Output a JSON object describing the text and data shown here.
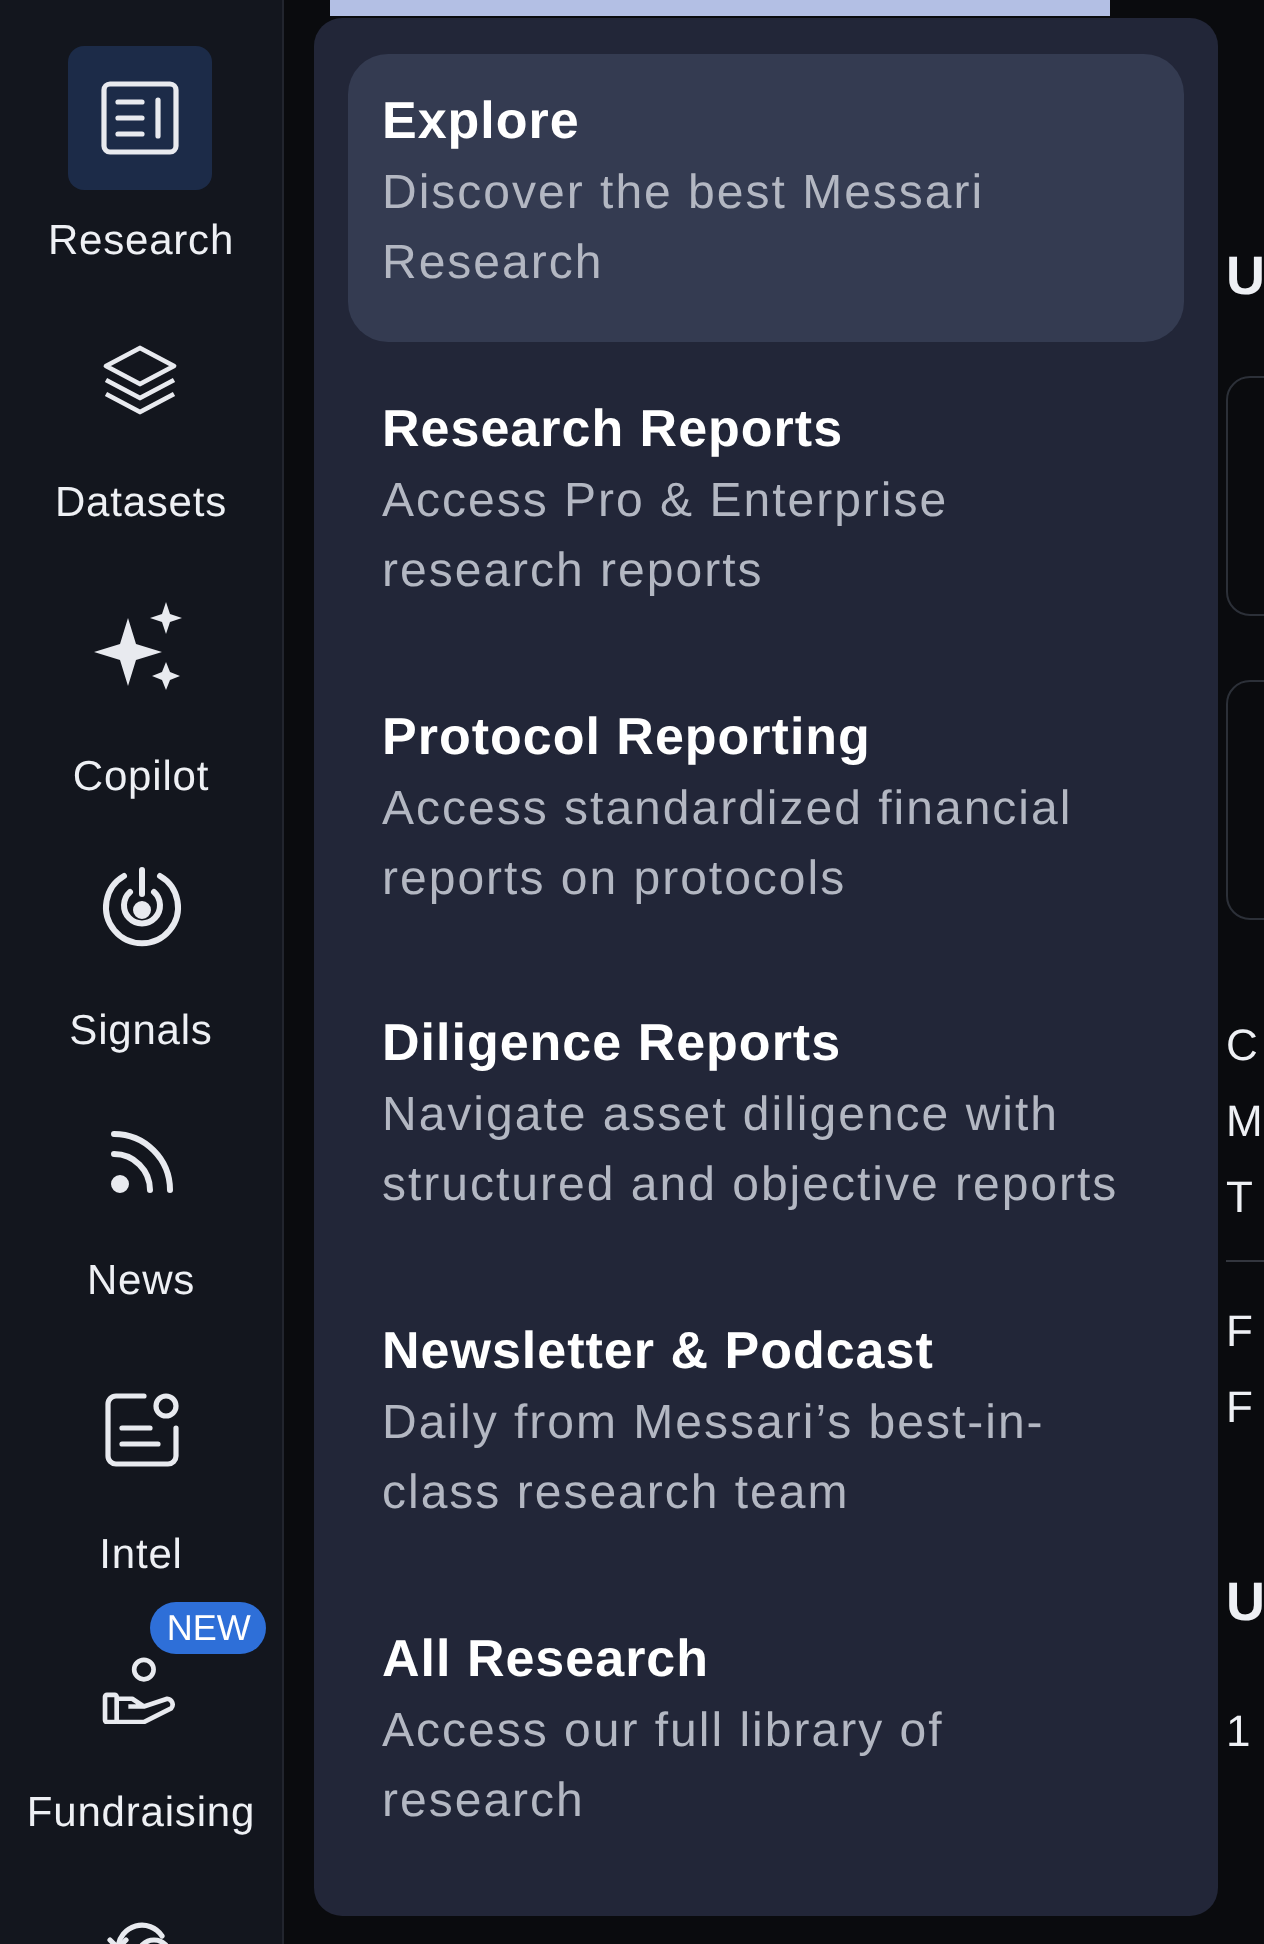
{
  "sidebar": {
    "items": [
      {
        "label": "Research",
        "selected": true
      },
      {
        "label": "Datasets",
        "selected": false
      },
      {
        "label": "Copilot",
        "selected": false
      },
      {
        "label": "Signals",
        "selected": false
      },
      {
        "label": "News",
        "selected": false
      },
      {
        "label": "Intel",
        "selected": false
      },
      {
        "label": "Fundraising",
        "selected": false,
        "badge": "NEW"
      },
      {
        "selected": false
      }
    ]
  },
  "background": {
    "heading": "U",
    "lines": [
      "C",
      "M",
      "T"
    ],
    "lines_2": [
      "F",
      "F"
    ],
    "heading_2": "U",
    "line_3": "1"
  },
  "menu": {
    "items": [
      {
        "title": "Explore",
        "description": "Discover the best Messari Research",
        "selected": true
      },
      {
        "title": "Research Reports",
        "description": "Access Pro & Enterprise research reports",
        "selected": false
      },
      {
        "title": "Protocol Reporting",
        "description": "Access standardized financial reports on protocols",
        "selected": false
      },
      {
        "title": "Diligence Reports",
        "description": "Navigate asset diligence with structured and objective reports",
        "selected": false
      },
      {
        "title": "Newsletter & Podcast",
        "description": "Daily from Messari’s best-in-class research team",
        "selected": false
      },
      {
        "title": "All Research",
        "description": "Access our full library of research",
        "selected": false
      }
    ]
  }
}
